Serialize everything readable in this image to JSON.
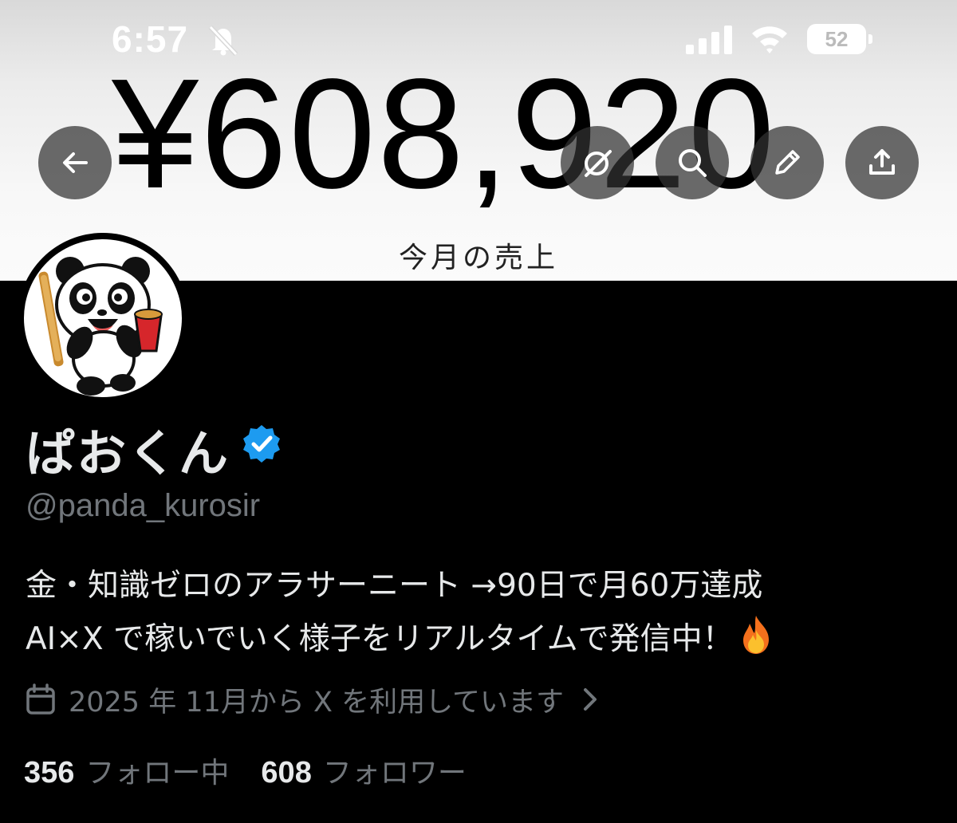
{
  "status_bar": {
    "time": "6:57",
    "battery": "52",
    "icons": [
      "bell-slash-icon",
      "cellular-signal-icon",
      "wifi-icon",
      "battery-icon"
    ]
  },
  "banner": {
    "amount": "¥608,920",
    "caption": "今月の売上"
  },
  "nav": {
    "icons": [
      "back-arrow-icon",
      "grok-icon",
      "search-icon",
      "edit-pencil-icon",
      "share-icon"
    ]
  },
  "profile": {
    "display_name": "ぱおくん",
    "verified": true,
    "handle": "@panda_kurosir",
    "bio_line1": "金・知識ゼロのアラサーニート →90日で月60万達成",
    "bio_line2": "AI×X で稼いでいく様子をリアルタイムで発信中！",
    "bio_emoji": "fire-icon",
    "joined": "2025 年 11月から X を利用しています",
    "following_count": "356",
    "following_label": "フォロー中",
    "followers_count": "608",
    "followers_label": "フォロワー"
  },
  "colors": {
    "background": "#000000",
    "text_primary": "#e7e9ea",
    "text_secondary": "#71767b",
    "verified_blue": "#1d9bf0"
  }
}
